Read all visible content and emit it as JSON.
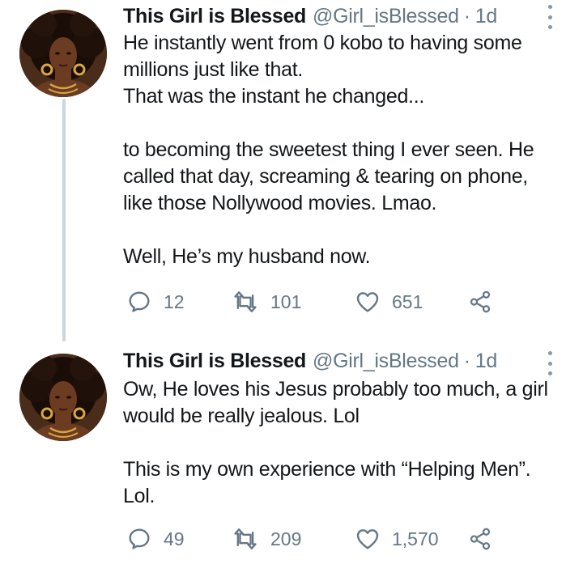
{
  "tweets": [
    {
      "author_name": "This Girl is Blessed",
      "handle": "@Girl_isBlessed",
      "separator": "·",
      "time": "1d",
      "avatar_icon": "woman-avatar",
      "lines": [
        "He instantly went from 0 kobo to having some",
        "millions just like that.",
        "That was the instant he changed...",
        "",
        "to becoming the sweetest thing I ever seen. He",
        "called that day, screaming & tearing on phone,",
        "like those Nollywood movies. Lmao.",
        "",
        "Well, He’s my husband now."
      ],
      "replies": "12",
      "retweets": "101",
      "likes": "651"
    },
    {
      "author_name": "This Girl is Blessed",
      "handle": "@Girl_isBlessed",
      "separator": "·",
      "time": "1d",
      "avatar_icon": "woman-avatar",
      "lines": [
        "Ow, He loves his Jesus probably too much, a girl",
        "would be really jealous. Lol",
        "",
        "This is my own experience with “Helping Men”.",
        "Lol."
      ],
      "replies": "49",
      "retweets": "209",
      "likes": "1,570"
    }
  ],
  "colors": {
    "text": "#14171a",
    "secondary": "#657786",
    "thread_line": "#ccd6dd"
  }
}
